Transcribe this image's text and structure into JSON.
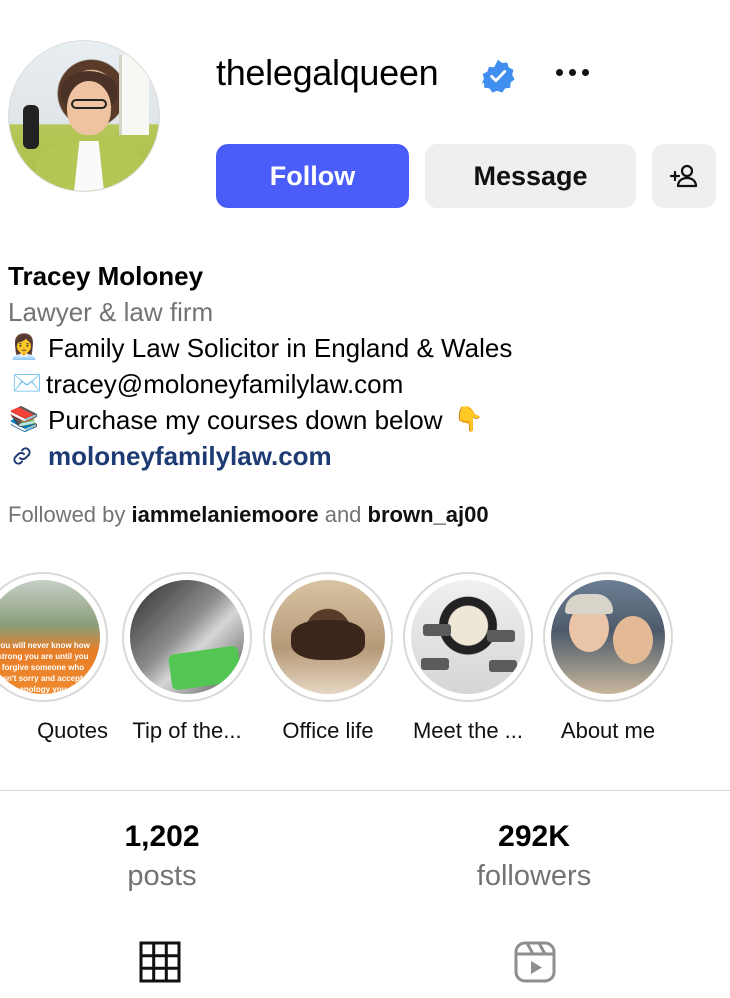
{
  "profile": {
    "username": "thelegalqueen",
    "verified_icon": "verified-badge-icon",
    "more_icon": "more-options-icon",
    "follow_label": "Follow",
    "message_label": "Message",
    "add_user_icon": "add-user-icon",
    "accent_color": "#4a5df9"
  },
  "bio": {
    "name": "Tracey Moloney",
    "category": "Lawyer & law firm",
    "line1_emoji": "👩‍💼",
    "line1": "Family Law Solicitor in England & Wales",
    "line2_emoji": "✉️",
    "line2": "tracey@moloneyfamilylaw.com",
    "line3_emoji": "📚",
    "line3": "Purchase my courses down below",
    "line3_trailing_emoji": "👇",
    "link": "moloneyfamilylaw.com",
    "link_icon": "link-icon"
  },
  "followed_by": {
    "prefix": "Followed by ",
    "user1": "iammelaniemoore",
    "and": " and ",
    "user2": "brown_aj00"
  },
  "highlights": [
    {
      "label": "Quotes",
      "image_text": "you will never know how strong you are until you forgive someone who wasn't sorry and accept an apology you"
    },
    {
      "label": "Tip of the..."
    },
    {
      "label": "Office life"
    },
    {
      "label": "Meet the ..."
    },
    {
      "label": "About me"
    }
  ],
  "stats": {
    "posts_count": "1,202",
    "posts_label": "posts",
    "followers_count": "292K",
    "followers_label": "followers"
  },
  "tabs": {
    "grid_icon": "grid-icon",
    "reels_icon": "reels-icon"
  }
}
